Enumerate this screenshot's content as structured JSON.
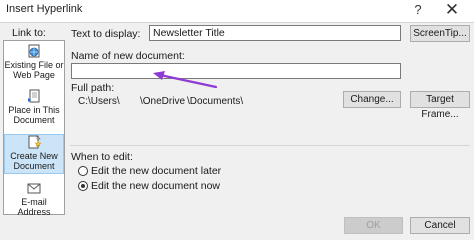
{
  "window": {
    "title": "Insert Hyperlink",
    "help_glyph": "?",
    "close_glyph": "✕"
  },
  "link_to": {
    "label": "Link to:",
    "items": [
      {
        "label_line1": "Existing File or",
        "label_line2": "Web Page",
        "selected": false,
        "icon": "globe-page-icon"
      },
      {
        "label_line1": "Place in This",
        "label_line2": "Document",
        "selected": false,
        "icon": "document-place-icon"
      },
      {
        "label_line1": "Create New",
        "label_line2": "Document",
        "selected": true,
        "icon": "new-document-icon"
      },
      {
        "label_line1": "E-mail Address",
        "label_line2": "",
        "selected": false,
        "icon": "email-icon"
      }
    ]
  },
  "text_to_display": {
    "label": "Text to display:",
    "value": "Newsletter Title"
  },
  "screentip_button": "ScreenTip...",
  "new_document": {
    "label": "Name of new document:",
    "value": ""
  },
  "full_path": {
    "label": "Full path:",
    "segments": [
      "C:\\Users\\",
      "\\OneDrive",
      "\\Documents\\"
    ]
  },
  "change_button": "Change...",
  "target_frame_button": "Target Frame...",
  "when_to_edit": {
    "label": "When to edit:",
    "options": [
      {
        "label": "Edit the new document later",
        "checked": false
      },
      {
        "label": "Edit the new document now",
        "checked": true
      }
    ]
  },
  "ok_button": "OK",
  "cancel_button": "Cancel",
  "colors": {
    "selection_bg": "#cce4f7",
    "annotation_arrow": "#8e3bd4",
    "dialog_bg": "#f0f0f0"
  }
}
